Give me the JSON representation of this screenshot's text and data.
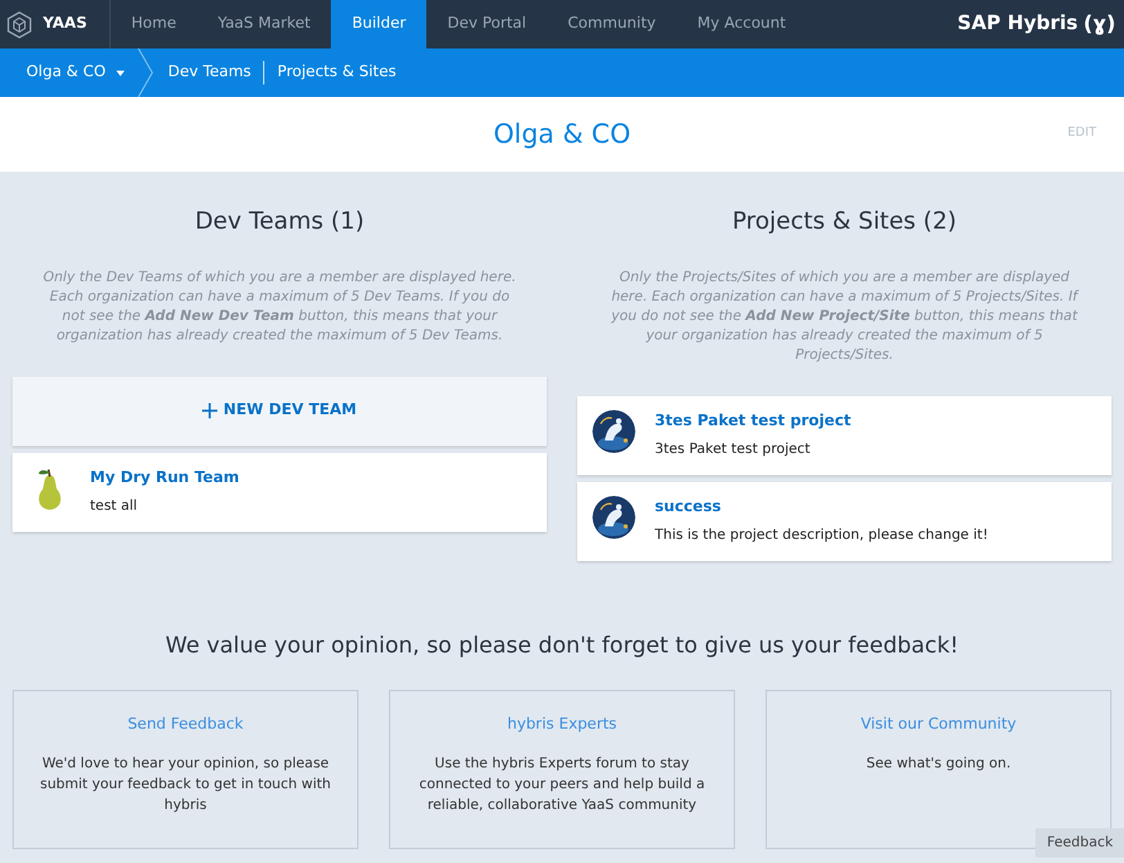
{
  "nav": {
    "brand": "YAAS",
    "items": [
      {
        "label": "Home",
        "selected": false
      },
      {
        "label": "YaaS Market",
        "selected": false
      },
      {
        "label": "Builder",
        "selected": true
      },
      {
        "label": "Dev Portal",
        "selected": false
      },
      {
        "label": "Community",
        "selected": false
      },
      {
        "label": "My Account",
        "selected": false
      }
    ],
    "logo": "SAP Hybris",
    "logo_mark": "(ɣ)"
  },
  "breadcrumb": {
    "org": "Olga & CO",
    "links": [
      "Dev Teams",
      "Projects & Sites"
    ]
  },
  "page": {
    "title": "Olga & CO",
    "edit": "EDIT"
  },
  "columns": [
    {
      "heading": "Dev Teams (1)",
      "description": "Only the Dev Teams of which you are a member are displayed here. Each organization can have a maximum of 5 Dev Teams. If you do not see the **Add New Dev Team** button, this means that your organization has already created the maximum of 5 Dev Teams.",
      "add_button": "NEW DEV TEAM",
      "items": [
        {
          "kind": "pear",
          "name": "My Dry Run Team",
          "description": "test all"
        }
      ]
    },
    {
      "heading": "Projects & Sites (2)",
      "description": "Only the Projects/Sites of which you are a member are displayed here. Each organization can have a maximum of 5 Projects/Sites. If you do not see the **Add New Project/Site** button, this means that your organization has already created the maximum of 5 Projects/Sites.",
      "items": [
        {
          "kind": "picture",
          "name": "3tes Paket test project",
          "description": "3tes Paket test project"
        },
        {
          "kind": "picture",
          "name": "success",
          "description": "This is the project description, please change it!"
        }
      ]
    }
  ],
  "feedback": {
    "heading": "We value your opinion, so please don't forget to give us your feedback!",
    "cards": [
      {
        "title": "Send Feedback",
        "text": "We'd love to hear your opinion, so please submit your feedback to get in touch with hybris"
      },
      {
        "title": "hybris Experts",
        "text": "Use the hybris Experts forum to stay connected to your peers and help build a reliable, collaborative YaaS community"
      },
      {
        "title": "Visit our Community",
        "text": "See what's going on."
      }
    ]
  },
  "feedback_tab": "Feedback"
}
